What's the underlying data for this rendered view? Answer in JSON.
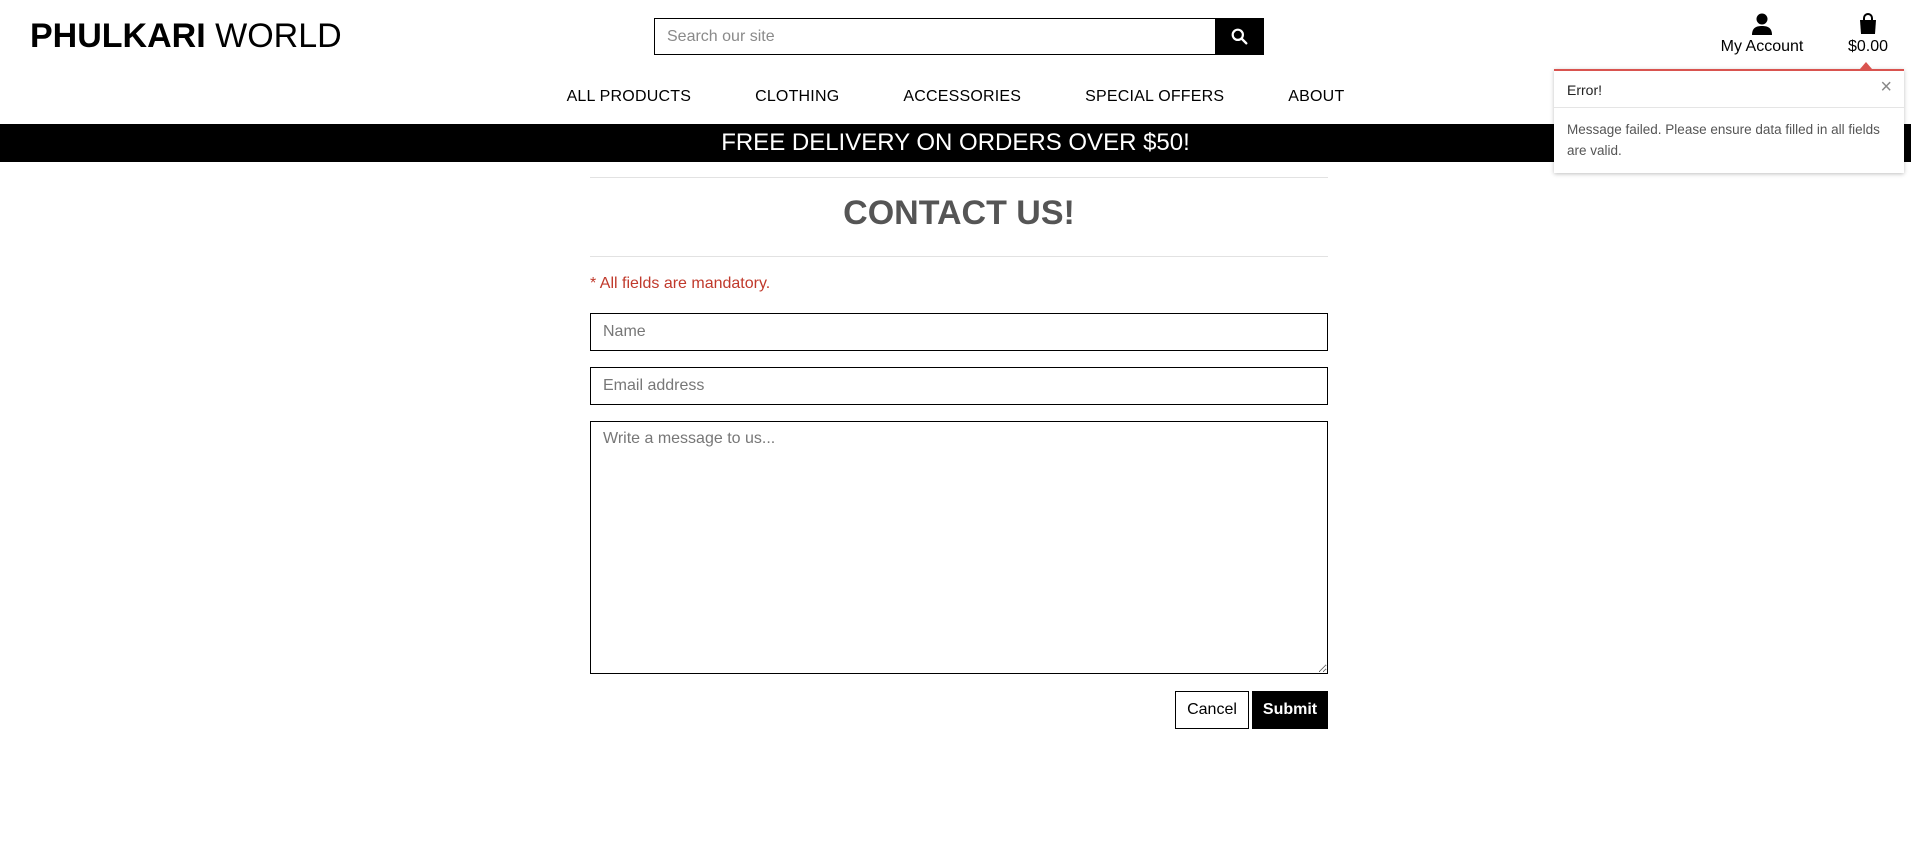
{
  "brand": {
    "bold": "PHULKARI",
    "light": "WORLD"
  },
  "search": {
    "placeholder": "Search our site",
    "value": "",
    "icon": "search-icon"
  },
  "account": {
    "label": "My Account",
    "icon": "user-icon"
  },
  "cart": {
    "total": "$0.00",
    "icon": "shopping-bag-icon"
  },
  "nav": {
    "items": [
      "ALL PRODUCTS",
      "CLOTHING",
      "ACCESSORIES",
      "SPECIAL OFFERS",
      "ABOUT"
    ]
  },
  "banner": "FREE DELIVERY ON ORDERS OVER $50!",
  "toast": {
    "title": "Error!",
    "close": "×",
    "message": "Message failed. Please ensure data filled in all fields are valid.",
    "accent": "#d9534f"
  },
  "contact": {
    "heading": "CONTACT US!",
    "mandatory": "* All fields are mandatory.",
    "name_placeholder": "Name",
    "email_placeholder": "Email address",
    "message_placeholder": "Write a message to us...",
    "cancel": "Cancel",
    "submit": "Submit"
  },
  "colors": {
    "primary": "#000000",
    "error": "#c0392b",
    "banner_text": "#ffffff"
  }
}
